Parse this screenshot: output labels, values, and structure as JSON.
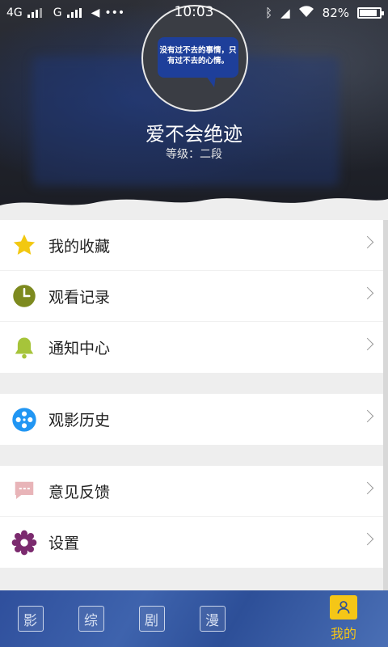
{
  "status_bar": {
    "network_left": "4G",
    "network_mid": "G",
    "more": "•••",
    "time": "10:03",
    "battery": "82%",
    "battery_level": 0.82
  },
  "profile": {
    "avatar_text": "没有过不去的事情，只有过不去的心情。",
    "name": "爱不会绝迹",
    "level": "等级：二段"
  },
  "menu": {
    "groups": [
      {
        "items": [
          {
            "label": "我的收藏",
            "icon": "star-icon",
            "color": "#f2c811"
          },
          {
            "label": "观看记录",
            "icon": "clock-icon",
            "color": "#7d8a1f"
          },
          {
            "label": "通知中心",
            "icon": "bell-icon",
            "color": "#a6c43a"
          }
        ]
      },
      {
        "items": [
          {
            "label": "观影历史",
            "icon": "film-reel-icon",
            "color": "#2196f3"
          }
        ]
      },
      {
        "items": [
          {
            "label": "意见反馈",
            "icon": "chat-bubble-icon",
            "color": "#e8b4b8"
          },
          {
            "label": "设置",
            "icon": "gear-icon",
            "color": "#7b2a6e"
          }
        ]
      }
    ]
  },
  "bottom_nav": {
    "tabs": [
      {
        "label": "影"
      },
      {
        "label": "综"
      },
      {
        "label": "剧"
      },
      {
        "label": "漫"
      }
    ],
    "active": {
      "label": "我的",
      "color": "#f5c617"
    }
  }
}
